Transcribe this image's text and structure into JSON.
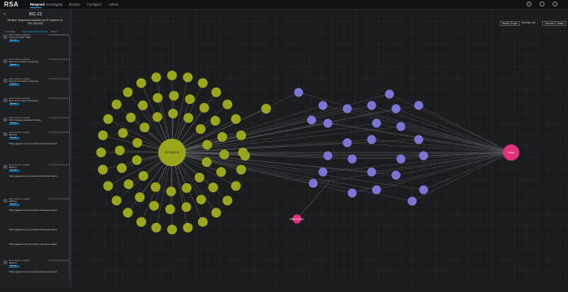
{
  "app": {
    "logo": "RSA"
  },
  "nav": {
    "tabs": [
      {
        "label": "Respond",
        "active": true
      },
      {
        "label": "Investigate",
        "active": false
      },
      {
        "label": "Monitor",
        "active": false
      },
      {
        "label": "Configure",
        "active": false
      },
      {
        "label": "Admin",
        "active": false
      }
    ]
  },
  "sidebar": {
    "incident_id": "INC-23",
    "back_label": "<",
    "subtitle": "Multiple Suspicious Activities for IP address for 192.168.8.63",
    "tabs": [
      "JOURNAL",
      "RELATED INDICATORS",
      "TASKS"
    ],
    "items": [
      {
        "source": "Event Stream Analysis",
        "title": "Abnormal Traffic Traffic",
        "time": "07/27/2019 01:03:04 pm",
        "chip": "Reveal...",
        "icon": "alert-icon"
      },
      {
        "source": "Event Stream Analysis",
        "title": "Brute Force Pattern 2 Detecting",
        "time": "07/27/2019 01:03:04 pm",
        "chip": "Reveal...",
        "icon": "alert-icon"
      },
      {
        "source": "Event Stream Analysis",
        "title": "Brute Force Pattern 4 Detecting",
        "time": "07/27/2019 01:03:04 pm",
        "chip": "Reveal...",
        "icon": "alert-icon"
      },
      {
        "source": "Event Stream Analysis",
        "title": "Brute Force Pattern 3 Detecting",
        "time": "07/27/2019 01:03:04 pm",
        "chip": "Reveal...",
        "icon": "alert-icon"
      },
      {
        "source": "Event Stream Analysis",
        "title": "NTLM Strategy Escalation Module",
        "time": "07/27/2019 01:03:04 pm",
        "chip": "Reveal...",
        "icon": "alert-icon"
      },
      {
        "source": "Event Stream Analysis",
        "title": "Warning",
        "time": "07/27/2019 01:03:04 pm",
        "chip": "Reveal...",
        "icon": "alert-icon"
      },
      {
        "source": "Event Stream Analysis",
        "title": "Warning",
        "time": "07/27/2019 01:03:04 pm",
        "chip": "Reveal...",
        "icon": "alert-icon"
      }
    ],
    "note": "There appears to be no events in this event context."
  },
  "graph": {
    "toolbar": {
      "nodal_graph": "Nodal Graph",
      "events_list": "Events List",
      "journal_tasks": "Journal & Tasks"
    },
    "hub_label": "192.168.8.63",
    "target_label": "Target",
    "lone_label": "Finance Server",
    "colors": {
      "green": "#9aa61c",
      "purple": "#7b76d6",
      "pink": "#e0317f",
      "edge": "#6a6b6e",
      "accent": "#1ea0e6"
    }
  }
}
